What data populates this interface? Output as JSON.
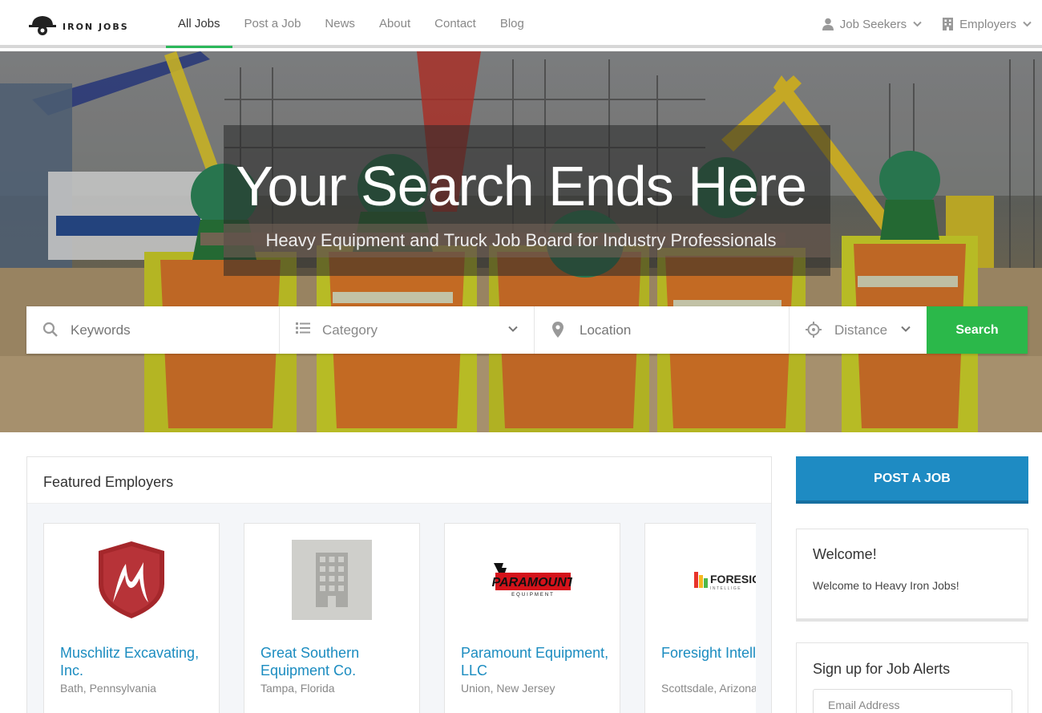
{
  "header": {
    "logo_text": "IRON JOBS",
    "nav": [
      {
        "label": "All Jobs",
        "active": true
      },
      {
        "label": "Post a Job"
      },
      {
        "label": "News"
      },
      {
        "label": "About"
      },
      {
        "label": "Contact"
      },
      {
        "label": "Blog"
      }
    ],
    "job_seekers_label": "Job Seekers",
    "employers_label": "Employers"
  },
  "hero": {
    "title": "Your Search Ends Here",
    "subtitle": "Heavy Equipment and Truck Job Board for Industry Professionals"
  },
  "search": {
    "keywords_placeholder": "Keywords",
    "category_value": "Category",
    "location_placeholder": "Location",
    "distance_value": "Distance",
    "button_label": "Search"
  },
  "featured": {
    "heading": "Featured Employers",
    "employers": [
      {
        "name": "Muschlitz Excavating, Inc.",
        "location": "Bath, Pennsylvania",
        "logo": "shield-m-logo"
      },
      {
        "name": "Great Southern Equipment Co.",
        "location": "Tampa, Florida",
        "logo": "building-placeholder-icon"
      },
      {
        "name": "Paramount Equipment, LLC",
        "location": "Union, New Jersey",
        "logo": "paramount-logo",
        "logo_text": "PARAMOUNT",
        "logo_subtext": "EQUIPMENT"
      },
      {
        "name": "Foresight Intelligence®",
        "location": "Scottsdale, Arizona",
        "logo": "foresight-logo",
        "logo_text": "FORESIG",
        "logo_subtext": "INTELLIGE"
      }
    ]
  },
  "sidebar": {
    "post_job_label": "POST A JOB",
    "welcome_title": "Welcome!",
    "welcome_text": "Welcome to Heavy Iron Jobs!",
    "alerts_title": "Sign up for Job Alerts",
    "email_placeholder": "Email Address"
  },
  "colors": {
    "accent_green": "#2bb84a",
    "link_blue": "#1b8cc0",
    "button_blue": "#1e8bc3"
  }
}
